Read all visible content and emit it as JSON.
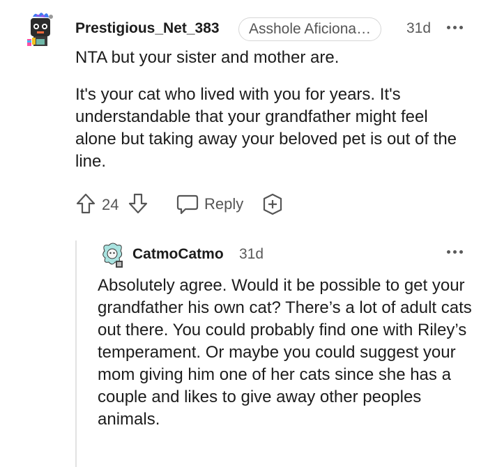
{
  "comment": {
    "username": "Prestigious_Net_383",
    "flair": "Asshole Aficiona…",
    "age": "31d",
    "paragraphs": [
      "NTA but your sister and mother are.",
      "It's your cat who lived with you for years. It's understandable that your grandfather might feel alone but taking away your beloved pet is out of the line."
    ],
    "score": "24",
    "reply_label": "Reply"
  },
  "reply": {
    "username": "CatmoCatmo",
    "age": "31d",
    "paragraphs": [
      "Absolutely agree. Would it be possible to get your grandfather his own cat? There’s a lot of adult cats out there. You could probably find one with Riley’s temperament. Or maybe you could suggest your mom giving him one of her cats since she has a couple and likes to give away other peoples animals."
    ]
  },
  "icons": {
    "upvote": "upvote-arrow-icon",
    "downvote": "downvote-arrow-icon",
    "reply": "speech-bubble-icon",
    "award": "award-plus-icon",
    "more": "ellipsis-icon"
  }
}
